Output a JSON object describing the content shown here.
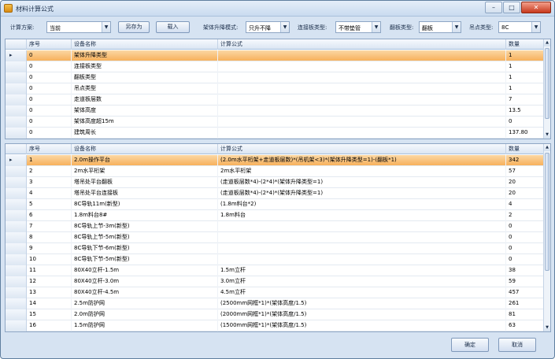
{
  "window": {
    "title": "材料计算公式"
  },
  "toolbar": {
    "scheme_label": "计算方案:",
    "scheme_value": "当前",
    "save_as_label": "另存为",
    "import_label": "载入",
    "lift_mode_label": "架体升降模式:",
    "lift_mode_value": "只升不降",
    "connector_type_label": "连接板类型:",
    "connector_type_value": "不带垫管",
    "flip_type_label": "翻板类型:",
    "flip_type_value": "翻板",
    "hang_type_label": "吊点类型:",
    "hang_type_value": "8C"
  },
  "grid1": {
    "headers": {
      "seq": "序号",
      "name": "设备名称",
      "formula": "计算公式",
      "qty": "数量"
    },
    "rows": [
      {
        "seq": "0",
        "name": "架体升降类型",
        "formula": "",
        "qty": "1"
      },
      {
        "seq": "0",
        "name": "连接板类型",
        "formula": "",
        "qty": "1"
      },
      {
        "seq": "0",
        "name": "翻板类型",
        "formula": "",
        "qty": "1"
      },
      {
        "seq": "0",
        "name": "吊点类型",
        "formula": "",
        "qty": "1"
      },
      {
        "seq": "0",
        "name": "走道板层数",
        "formula": "",
        "qty": "7"
      },
      {
        "seq": "0",
        "name": "架体高度",
        "formula": "",
        "qty": "13.5"
      },
      {
        "seq": "0",
        "name": "架体高度超15m",
        "formula": "",
        "qty": "0"
      },
      {
        "seq": "0",
        "name": "建筑周长",
        "formula": "",
        "qty": "137.80"
      }
    ]
  },
  "grid2": {
    "headers": {
      "seq": "序号",
      "name": "设备名称",
      "formula": "计算公式",
      "qty": "数量"
    },
    "rows": [
      {
        "seq": "1",
        "name": "2.0m操作平台",
        "formula": "(2.0m水平桁架+走道板层数)*(吊机架<3)*(架体升降类型=1)-(翻板*1)",
        "qty": "342"
      },
      {
        "seq": "2",
        "name": "2m水平桁架",
        "formula": "2m水平桁架",
        "qty": "57"
      },
      {
        "seq": "3",
        "name": "塔吊处平台翻板",
        "formula": "(走道板层数*4)-(2*4)*(架体升降类型=1)",
        "qty": "20"
      },
      {
        "seq": "4",
        "name": "塔吊处平台连接板",
        "formula": "(走道板层数*4)-(2*4)*(架体升降类型=1)",
        "qty": "20"
      },
      {
        "seq": "5",
        "name": "8C导轨11m(新型)",
        "formula": "(1.8m料台*2)",
        "qty": "4"
      },
      {
        "seq": "6",
        "name": "1.8m料台8#",
        "formula": "1.8m料台",
        "qty": "2"
      },
      {
        "seq": "7",
        "name": "8C导轨上节-3m(新型)",
        "formula": "",
        "qty": "0"
      },
      {
        "seq": "8",
        "name": "8C导轨上节-5m(新型)",
        "formula": "",
        "qty": "0"
      },
      {
        "seq": "9",
        "name": "8C导轨下节-6m(新型)",
        "formula": "",
        "qty": "0"
      },
      {
        "seq": "10",
        "name": "8C导轨下节-5m(新型)",
        "formula": "",
        "qty": "0"
      },
      {
        "seq": "11",
        "name": "80X40立杆-1.5m",
        "formula": "1.5m立杆",
        "qty": "38"
      },
      {
        "seq": "12",
        "name": "80X40立杆-3.0m",
        "formula": "3.0m立杆",
        "qty": "59"
      },
      {
        "seq": "13",
        "name": "80X40立杆-4.5m",
        "formula": "4.5m立杆",
        "qty": "457"
      },
      {
        "seq": "14",
        "name": "2.5m防护网",
        "formula": "(2500mm网框*1)*(架体高度/1.5)",
        "qty": "261"
      },
      {
        "seq": "15",
        "name": "2.0m防护网",
        "formula": "(2000mm网框*1)*(架体高度/1.5)",
        "qty": "81"
      },
      {
        "seq": "16",
        "name": "1.5m防护网",
        "formula": "(1500mm网框*1)*(架体高度/1.5)",
        "qty": "63"
      }
    ]
  },
  "footer": {
    "ok_label": "确定",
    "cancel_label": "取消"
  }
}
